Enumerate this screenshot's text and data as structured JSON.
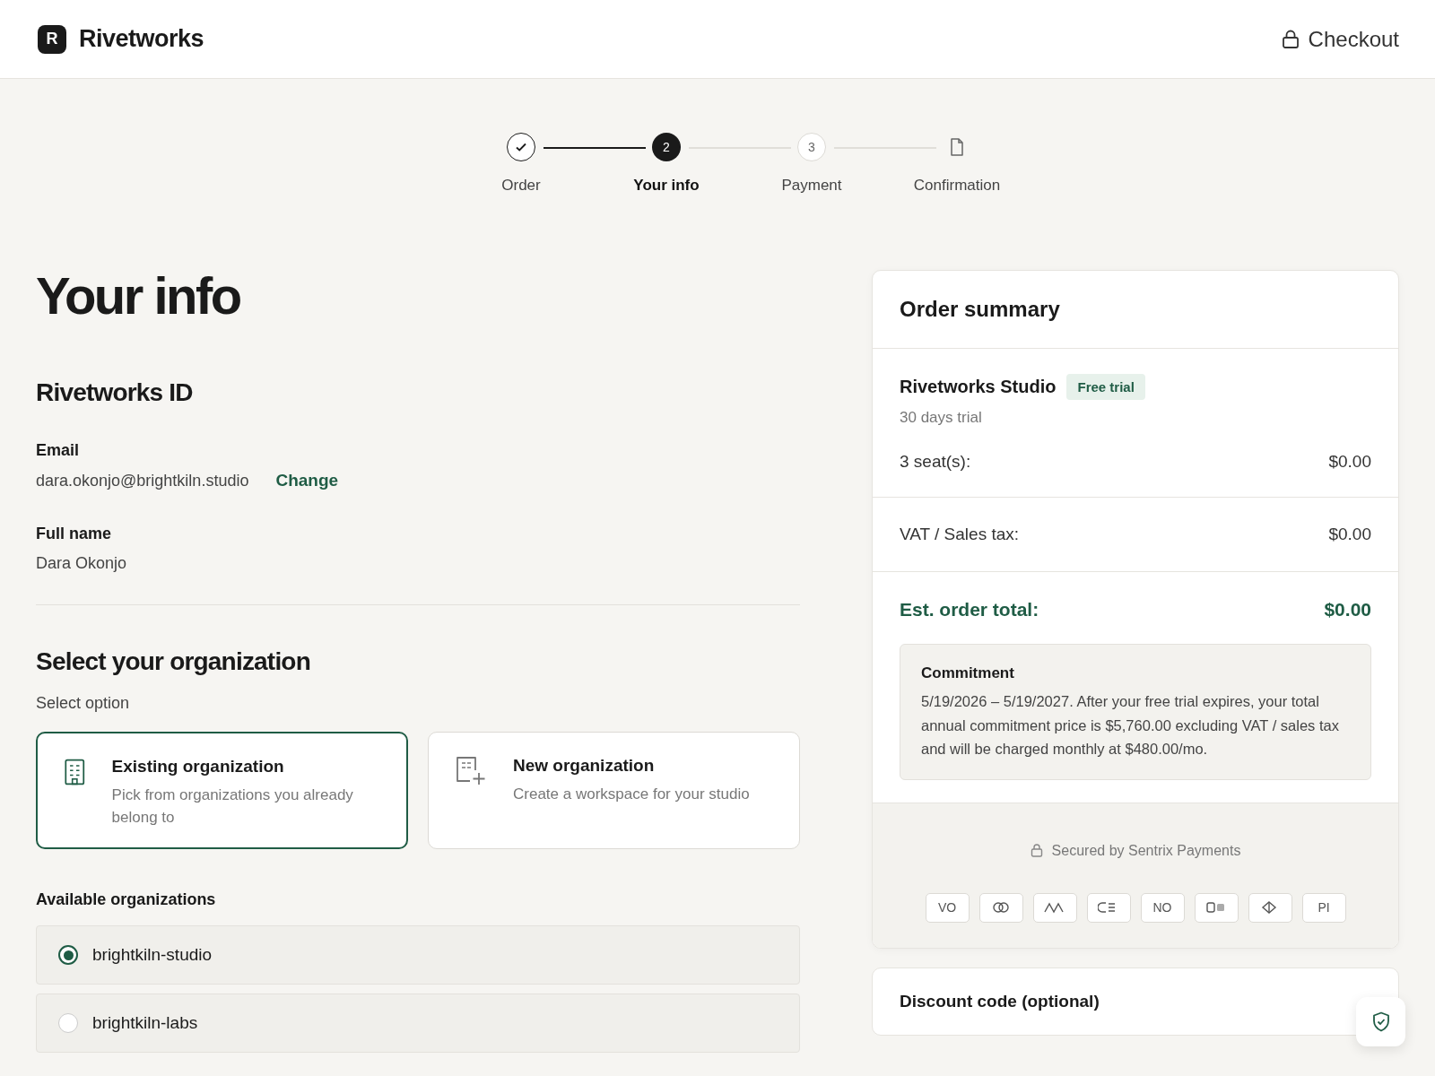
{
  "header": {
    "logo_letter": "R",
    "brand": "Rivetworks",
    "checkout": "Checkout"
  },
  "steps": [
    {
      "label": "Order",
      "kind": "check",
      "completed": true,
      "selected": false
    },
    {
      "label": "Your info",
      "kind": "number",
      "number": "2",
      "completed": false,
      "selected": true
    },
    {
      "label": "Payment",
      "kind": "number",
      "number": "3",
      "completed": false,
      "selected": false
    },
    {
      "label": "Confirmation",
      "kind": "document",
      "completed": false,
      "selected": false
    }
  ],
  "page_title": "Your info",
  "account": {
    "heading": "Rivetworks ID",
    "fields": [
      {
        "label": "Email",
        "value": "dara.okonjo@brightkiln.studio",
        "action": "Change"
      },
      {
        "label": "Full name",
        "value": "Dara Okonjo"
      }
    ]
  },
  "organization": {
    "heading": "Select your organization",
    "hint": "Select option",
    "options": [
      {
        "kind": "existing",
        "title": "Existing organization",
        "description": "Pick from organizations you already belong to",
        "selected": true
      },
      {
        "kind": "new",
        "title": "New organization",
        "description": "Create a workspace for your studio",
        "selected": false
      }
    ]
  },
  "available": {
    "heading": "Available organizations",
    "orgs": [
      {
        "name": "brightkiln-studio",
        "selected": true
      },
      {
        "name": "brightkiln-labs",
        "selected": false
      }
    ]
  },
  "summary": {
    "title": "Order summary",
    "product": {
      "name": "Rivetworks Studio",
      "badge": "Free trial",
      "subtitle": "30 days trial"
    },
    "lines": [
      {
        "label": "3 seat(s):",
        "value": "$0.00"
      },
      {
        "label": "VAT / Sales tax:",
        "value": "$0.00"
      }
    ],
    "total": {
      "label": "Est. order total:",
      "value": "$0.00"
    },
    "commitment": {
      "title": "Commitment",
      "text": "5/19/2026 – 5/19/2027. After your free trial expires, your total annual commitment price is $5,760.00 excluding VAT / sales tax and will be charged monthly at $480.00/mo."
    },
    "secured": "Secured by Sentrix Payments",
    "payment_methods": [
      {
        "kind": "text",
        "label": "VO"
      },
      {
        "kind": "rings"
      },
      {
        "kind": "zigzag"
      },
      {
        "kind": "lines"
      },
      {
        "kind": "text",
        "label": "NO"
      },
      {
        "kind": "toggle"
      },
      {
        "kind": "diamond"
      },
      {
        "kind": "text",
        "label": "PI"
      }
    ]
  },
  "discount": {
    "label": "Discount code (optional)"
  }
}
